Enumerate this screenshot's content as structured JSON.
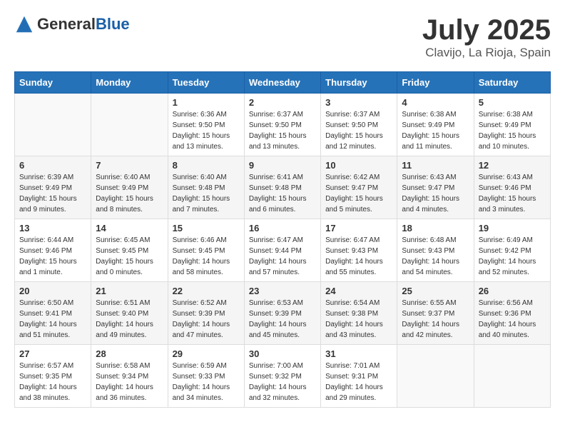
{
  "logo": {
    "general": "General",
    "blue": "Blue"
  },
  "header": {
    "month": "July 2025",
    "location": "Clavijo, La Rioja, Spain"
  },
  "weekdays": [
    "Sunday",
    "Monday",
    "Tuesday",
    "Wednesday",
    "Thursday",
    "Friday",
    "Saturday"
  ],
  "weeks": [
    [
      {
        "day": "",
        "info": ""
      },
      {
        "day": "",
        "info": ""
      },
      {
        "day": "1",
        "info": "Sunrise: 6:36 AM\nSunset: 9:50 PM\nDaylight: 15 hours and 13 minutes."
      },
      {
        "day": "2",
        "info": "Sunrise: 6:37 AM\nSunset: 9:50 PM\nDaylight: 15 hours and 13 minutes."
      },
      {
        "day": "3",
        "info": "Sunrise: 6:37 AM\nSunset: 9:50 PM\nDaylight: 15 hours and 12 minutes."
      },
      {
        "day": "4",
        "info": "Sunrise: 6:38 AM\nSunset: 9:49 PM\nDaylight: 15 hours and 11 minutes."
      },
      {
        "day": "5",
        "info": "Sunrise: 6:38 AM\nSunset: 9:49 PM\nDaylight: 15 hours and 10 minutes."
      }
    ],
    [
      {
        "day": "6",
        "info": "Sunrise: 6:39 AM\nSunset: 9:49 PM\nDaylight: 15 hours and 9 minutes."
      },
      {
        "day": "7",
        "info": "Sunrise: 6:40 AM\nSunset: 9:49 PM\nDaylight: 15 hours and 8 minutes."
      },
      {
        "day": "8",
        "info": "Sunrise: 6:40 AM\nSunset: 9:48 PM\nDaylight: 15 hours and 7 minutes."
      },
      {
        "day": "9",
        "info": "Sunrise: 6:41 AM\nSunset: 9:48 PM\nDaylight: 15 hours and 6 minutes."
      },
      {
        "day": "10",
        "info": "Sunrise: 6:42 AM\nSunset: 9:47 PM\nDaylight: 15 hours and 5 minutes."
      },
      {
        "day": "11",
        "info": "Sunrise: 6:43 AM\nSunset: 9:47 PM\nDaylight: 15 hours and 4 minutes."
      },
      {
        "day": "12",
        "info": "Sunrise: 6:43 AM\nSunset: 9:46 PM\nDaylight: 15 hours and 3 minutes."
      }
    ],
    [
      {
        "day": "13",
        "info": "Sunrise: 6:44 AM\nSunset: 9:46 PM\nDaylight: 15 hours and 1 minute."
      },
      {
        "day": "14",
        "info": "Sunrise: 6:45 AM\nSunset: 9:45 PM\nDaylight: 15 hours and 0 minutes."
      },
      {
        "day": "15",
        "info": "Sunrise: 6:46 AM\nSunset: 9:45 PM\nDaylight: 14 hours and 58 minutes."
      },
      {
        "day": "16",
        "info": "Sunrise: 6:47 AM\nSunset: 9:44 PM\nDaylight: 14 hours and 57 minutes."
      },
      {
        "day": "17",
        "info": "Sunrise: 6:47 AM\nSunset: 9:43 PM\nDaylight: 14 hours and 55 minutes."
      },
      {
        "day": "18",
        "info": "Sunrise: 6:48 AM\nSunset: 9:43 PM\nDaylight: 14 hours and 54 minutes."
      },
      {
        "day": "19",
        "info": "Sunrise: 6:49 AM\nSunset: 9:42 PM\nDaylight: 14 hours and 52 minutes."
      }
    ],
    [
      {
        "day": "20",
        "info": "Sunrise: 6:50 AM\nSunset: 9:41 PM\nDaylight: 14 hours and 51 minutes."
      },
      {
        "day": "21",
        "info": "Sunrise: 6:51 AM\nSunset: 9:40 PM\nDaylight: 14 hours and 49 minutes."
      },
      {
        "day": "22",
        "info": "Sunrise: 6:52 AM\nSunset: 9:39 PM\nDaylight: 14 hours and 47 minutes."
      },
      {
        "day": "23",
        "info": "Sunrise: 6:53 AM\nSunset: 9:39 PM\nDaylight: 14 hours and 45 minutes."
      },
      {
        "day": "24",
        "info": "Sunrise: 6:54 AM\nSunset: 9:38 PM\nDaylight: 14 hours and 43 minutes."
      },
      {
        "day": "25",
        "info": "Sunrise: 6:55 AM\nSunset: 9:37 PM\nDaylight: 14 hours and 42 minutes."
      },
      {
        "day": "26",
        "info": "Sunrise: 6:56 AM\nSunset: 9:36 PM\nDaylight: 14 hours and 40 minutes."
      }
    ],
    [
      {
        "day": "27",
        "info": "Sunrise: 6:57 AM\nSunset: 9:35 PM\nDaylight: 14 hours and 38 minutes."
      },
      {
        "day": "28",
        "info": "Sunrise: 6:58 AM\nSunset: 9:34 PM\nDaylight: 14 hours and 36 minutes."
      },
      {
        "day": "29",
        "info": "Sunrise: 6:59 AM\nSunset: 9:33 PM\nDaylight: 14 hours and 34 minutes."
      },
      {
        "day": "30",
        "info": "Sunrise: 7:00 AM\nSunset: 9:32 PM\nDaylight: 14 hours and 32 minutes."
      },
      {
        "day": "31",
        "info": "Sunrise: 7:01 AM\nSunset: 9:31 PM\nDaylight: 14 hours and 29 minutes."
      },
      {
        "day": "",
        "info": ""
      },
      {
        "day": "",
        "info": ""
      }
    ]
  ]
}
